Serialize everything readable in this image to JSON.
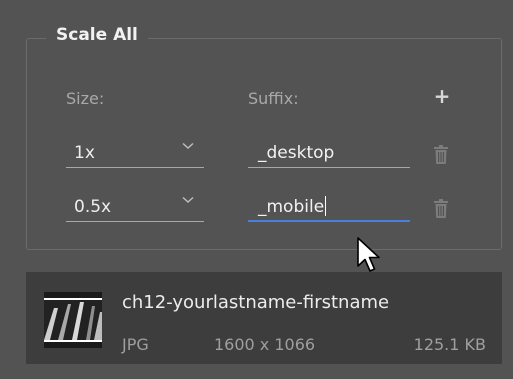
{
  "panel": {
    "title": "Scale All",
    "size_label": "Size:",
    "suffix_label": "Suffix:",
    "add_label": "+"
  },
  "rows": [
    {
      "size": "1x",
      "suffix": "_desktop"
    },
    {
      "size": "0.5x",
      "suffix": "_mobile"
    }
  ],
  "file": {
    "name": "ch12-yourlastname-firstname",
    "type": "JPG",
    "dimensions": "1600 x 1066",
    "size": "125.1 KB"
  },
  "colors": {
    "background": "#535353",
    "file_row_background": "#3d3d3d",
    "focus_underline": "#4a7fdd"
  },
  "icons": [
    "chevron-down-icon",
    "trash-icon",
    "plus-icon",
    "mouse-pointer-icon"
  ]
}
